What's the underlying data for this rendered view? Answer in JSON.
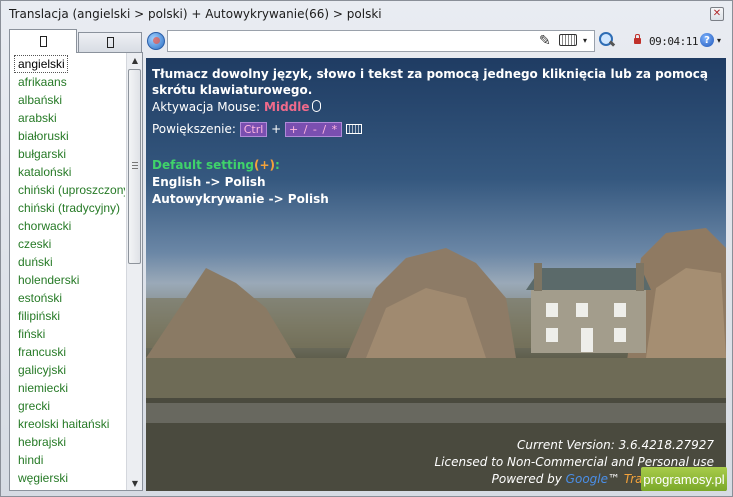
{
  "window": {
    "title": "Translacja (angielski > polski) + Autowykrywanie(66) > polski",
    "close_glyph": "✕"
  },
  "tabs": [
    {
      "label": ""
    },
    {
      "label": ""
    }
  ],
  "languages": [
    "angielski",
    "afrikaans",
    "albański",
    "arabski",
    "białoruski",
    "bułgarski",
    "kataloński",
    "chiński (uproszczony)",
    "chiński (tradycyjny)",
    "chorwacki",
    "czeski",
    "duński",
    "holenderski",
    "estoński",
    "filipiński",
    "fiński",
    "francuski",
    "galicyjski",
    "niemiecki",
    "grecki",
    "kreolski haitański",
    "hebrajski",
    "hindi",
    "węgierski"
  ],
  "selected_language": "angielski",
  "toolbar": {
    "search_value": "",
    "clock": "09:04:11",
    "help_glyph": "?",
    "pen_glyph": "✎",
    "dropdown_glyph": "▾"
  },
  "content": {
    "intro": "Tłumacz dowolny język, słowo i tekst za pomocą jednego kliknięcia lub za pomocą skrótu klawiaturowego.",
    "activation_label": "Aktywacja Mouse: ",
    "activation_value": "Middle",
    "zoom_label": "Powiększenie: ",
    "zoom_key": "Ctrl",
    "zoom_plus": " + ",
    "zoom_keys": "+ / - / *",
    "default_setting_label": "Default setting",
    "default_setting_paren": "(+)",
    "default_setting_colon": ":",
    "pair1": "English -> Polish",
    "pair2": "Autowykrywanie -> Polish",
    "version": "Current Version: 3.6.4218.27927",
    "license": "Licensed to Non-Commercial and Personal use",
    "powered_prefix": "Powered by ",
    "powered_google": "Google",
    "powered_tm": "™ ",
    "powered_links": "Translate, Dicti"
  },
  "watermark": "programosy.pl",
  "colors": {
    "accent_green": "#267a26",
    "activation_pink": "#f06a8b",
    "default_green": "#3fd36a",
    "orange": "#f3a23a"
  }
}
